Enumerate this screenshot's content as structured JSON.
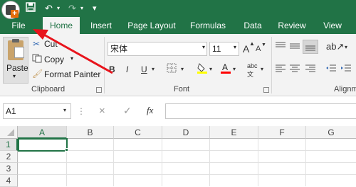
{
  "titlebar": {
    "save_icon": "save-icon",
    "undo_icon": "undo-icon",
    "redo_icon": "redo-icon",
    "customize_icon": "chevron-down-icon"
  },
  "tabs": [
    {
      "label": "File",
      "active": false
    },
    {
      "label": "Home",
      "active": true
    },
    {
      "label": "Insert",
      "active": false
    },
    {
      "label": "Page Layout",
      "active": false
    },
    {
      "label": "Formulas",
      "active": false
    },
    {
      "label": "Data",
      "active": false
    },
    {
      "label": "Review",
      "active": false
    },
    {
      "label": "View",
      "active": false
    }
  ],
  "clipboard": {
    "paste_label": "Paste",
    "cut_label": "Cut",
    "copy_label": "Copy",
    "format_painter_label": "Format Painter",
    "group_label": "Clipboard"
  },
  "font": {
    "font_name": "宋体",
    "font_size": "11",
    "bold": "B",
    "italic": "I",
    "underline": "U",
    "grow": "A",
    "shrink": "A",
    "group_label": "Font",
    "phonetic": "abc",
    "highlight_color": "#ffff00",
    "font_color": "#ff0000"
  },
  "alignment": {
    "group_label": "Alignme"
  },
  "formula_bar": {
    "name_box": "A1",
    "cancel_icon": "×",
    "enter_icon": "✓",
    "fx_label": "fx",
    "formula_value": ""
  },
  "grid": {
    "columns": [
      "A",
      "B",
      "C",
      "D",
      "E",
      "F",
      "G"
    ],
    "rows": [
      "1",
      "2",
      "3",
      "4"
    ],
    "selected_cell": "A1"
  },
  "colors": {
    "brand": "#217346",
    "arrow": "#e8141c",
    "ribbon_bg": "#f3f3f3"
  }
}
